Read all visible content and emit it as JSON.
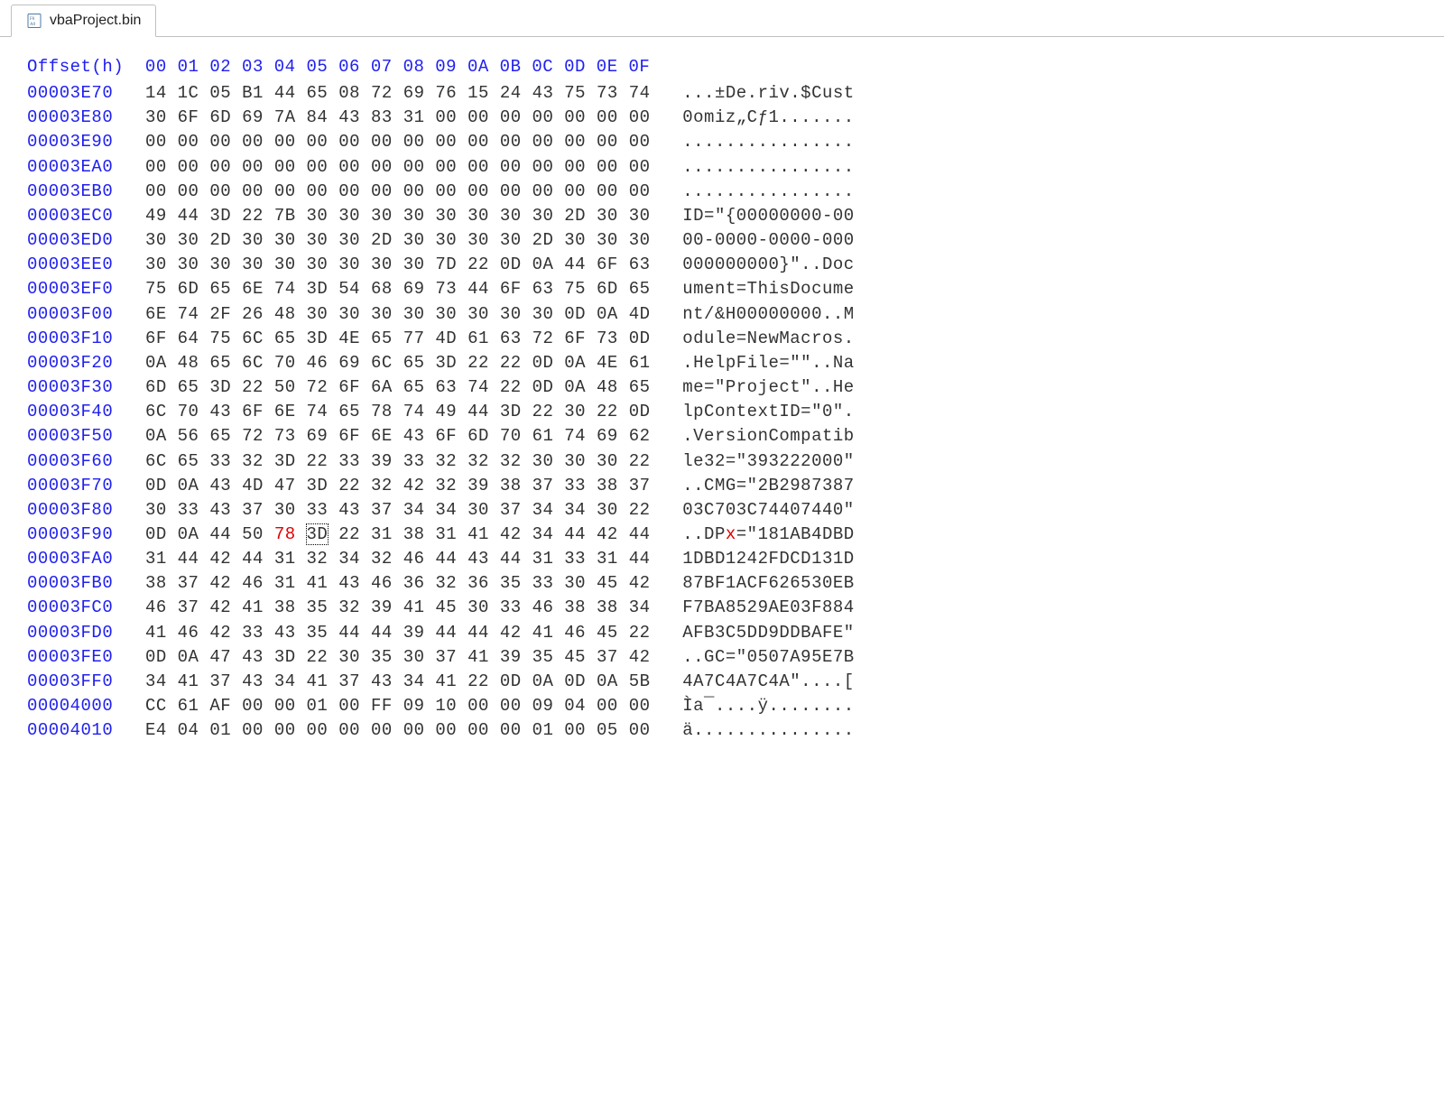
{
  "tab": {
    "title": "vbaProject.bin"
  },
  "header": "Offset(h)  00 01 02 03 04 05 06 07 08 09 0A 0B 0C 0D 0E 0F",
  "rows": [
    {
      "offset": "00003E70",
      "bytes": [
        "14",
        "1C",
        "05",
        "B1",
        "44",
        "65",
        "08",
        "72",
        "69",
        "76",
        "15",
        "24",
        "43",
        "75",
        "73",
        "74"
      ],
      "ascii": "...±De.riv.$Cust"
    },
    {
      "offset": "00003E80",
      "bytes": [
        "30",
        "6F",
        "6D",
        "69",
        "7A",
        "84",
        "43",
        "83",
        "31",
        "00",
        "00",
        "00",
        "00",
        "00",
        "00",
        "00"
      ],
      "ascii": "0omiz„Cƒ1......."
    },
    {
      "offset": "00003E90",
      "bytes": [
        "00",
        "00",
        "00",
        "00",
        "00",
        "00",
        "00",
        "00",
        "00",
        "00",
        "00",
        "00",
        "00",
        "00",
        "00",
        "00"
      ],
      "ascii": "................"
    },
    {
      "offset": "00003EA0",
      "bytes": [
        "00",
        "00",
        "00",
        "00",
        "00",
        "00",
        "00",
        "00",
        "00",
        "00",
        "00",
        "00",
        "00",
        "00",
        "00",
        "00"
      ],
      "ascii": "................"
    },
    {
      "offset": "00003EB0",
      "bytes": [
        "00",
        "00",
        "00",
        "00",
        "00",
        "00",
        "00",
        "00",
        "00",
        "00",
        "00",
        "00",
        "00",
        "00",
        "00",
        "00"
      ],
      "ascii": "................"
    },
    {
      "offset": "00003EC0",
      "bytes": [
        "49",
        "44",
        "3D",
        "22",
        "7B",
        "30",
        "30",
        "30",
        "30",
        "30",
        "30",
        "30",
        "30",
        "2D",
        "30",
        "30"
      ],
      "ascii": "ID=\"{00000000-00"
    },
    {
      "offset": "00003ED0",
      "bytes": [
        "30",
        "30",
        "2D",
        "30",
        "30",
        "30",
        "30",
        "2D",
        "30",
        "30",
        "30",
        "30",
        "2D",
        "30",
        "30",
        "30"
      ],
      "ascii": "00-0000-0000-000"
    },
    {
      "offset": "00003EE0",
      "bytes": [
        "30",
        "30",
        "30",
        "30",
        "30",
        "30",
        "30",
        "30",
        "30",
        "7D",
        "22",
        "0D",
        "0A",
        "44",
        "6F",
        "63"
      ],
      "ascii": "000000000}\"..Doc"
    },
    {
      "offset": "00003EF0",
      "bytes": [
        "75",
        "6D",
        "65",
        "6E",
        "74",
        "3D",
        "54",
        "68",
        "69",
        "73",
        "44",
        "6F",
        "63",
        "75",
        "6D",
        "65"
      ],
      "ascii": "ument=ThisDocume"
    },
    {
      "offset": "00003F00",
      "bytes": [
        "6E",
        "74",
        "2F",
        "26",
        "48",
        "30",
        "30",
        "30",
        "30",
        "30",
        "30",
        "30",
        "30",
        "0D",
        "0A",
        "4D"
      ],
      "ascii": "nt/&H00000000..M"
    },
    {
      "offset": "00003F10",
      "bytes": [
        "6F",
        "64",
        "75",
        "6C",
        "65",
        "3D",
        "4E",
        "65",
        "77",
        "4D",
        "61",
        "63",
        "72",
        "6F",
        "73",
        "0D"
      ],
      "ascii": "odule=NewMacros."
    },
    {
      "offset": "00003F20",
      "bytes": [
        "0A",
        "48",
        "65",
        "6C",
        "70",
        "46",
        "69",
        "6C",
        "65",
        "3D",
        "22",
        "22",
        "0D",
        "0A",
        "4E",
        "61"
      ],
      "ascii": ".HelpFile=\"\"..Na"
    },
    {
      "offset": "00003F30",
      "bytes": [
        "6D",
        "65",
        "3D",
        "22",
        "50",
        "72",
        "6F",
        "6A",
        "65",
        "63",
        "74",
        "22",
        "0D",
        "0A",
        "48",
        "65"
      ],
      "ascii": "me=\"Project\"..He"
    },
    {
      "offset": "00003F40",
      "bytes": [
        "6C",
        "70",
        "43",
        "6F",
        "6E",
        "74",
        "65",
        "78",
        "74",
        "49",
        "44",
        "3D",
        "22",
        "30",
        "22",
        "0D"
      ],
      "ascii": "lpContextID=\"0\"."
    },
    {
      "offset": "00003F50",
      "bytes": [
        "0A",
        "56",
        "65",
        "72",
        "73",
        "69",
        "6F",
        "6E",
        "43",
        "6F",
        "6D",
        "70",
        "61",
        "74",
        "69",
        "62"
      ],
      "ascii": ".VersionCompatib"
    },
    {
      "offset": "00003F60",
      "bytes": [
        "6C",
        "65",
        "33",
        "32",
        "3D",
        "22",
        "33",
        "39",
        "33",
        "32",
        "32",
        "32",
        "30",
        "30",
        "30",
        "22"
      ],
      "ascii": "le32=\"393222000\""
    },
    {
      "offset": "00003F70",
      "bytes": [
        "0D",
        "0A",
        "43",
        "4D",
        "47",
        "3D",
        "22",
        "32",
        "42",
        "32",
        "39",
        "38",
        "37",
        "33",
        "38",
        "37"
      ],
      "ascii": "..CMG=\"2B2987387"
    },
    {
      "offset": "00003F80",
      "bytes": [
        "30",
        "33",
        "43",
        "37",
        "30",
        "33",
        "43",
        "37",
        "34",
        "34",
        "30",
        "37",
        "34",
        "34",
        "30",
        "22"
      ],
      "ascii": "03C703C74407440\""
    },
    {
      "offset": "00003F90",
      "bytes": [
        "0D",
        "0A",
        "44",
        "50",
        "78",
        "3D",
        "22",
        "31",
        "38",
        "31",
        "41",
        "42",
        "34",
        "44",
        "42",
        "44"
      ],
      "ascii_pre": "..DP",
      "ascii_red": "x",
      "ascii_post": "=\"181AB4DBD",
      "red_byte_index": 4,
      "sel_byte_index": 5
    },
    {
      "offset": "00003FA0",
      "bytes": [
        "31",
        "44",
        "42",
        "44",
        "31",
        "32",
        "34",
        "32",
        "46",
        "44",
        "43",
        "44",
        "31",
        "33",
        "31",
        "44"
      ],
      "ascii": "1DBD1242FDCD131D"
    },
    {
      "offset": "00003FB0",
      "bytes": [
        "38",
        "37",
        "42",
        "46",
        "31",
        "41",
        "43",
        "46",
        "36",
        "32",
        "36",
        "35",
        "33",
        "30",
        "45",
        "42"
      ],
      "ascii": "87BF1ACF626530EB"
    },
    {
      "offset": "00003FC0",
      "bytes": [
        "46",
        "37",
        "42",
        "41",
        "38",
        "35",
        "32",
        "39",
        "41",
        "45",
        "30",
        "33",
        "46",
        "38",
        "38",
        "34"
      ],
      "ascii": "F7BA8529AE03F884"
    },
    {
      "offset": "00003FD0",
      "bytes": [
        "41",
        "46",
        "42",
        "33",
        "43",
        "35",
        "44",
        "44",
        "39",
        "44",
        "44",
        "42",
        "41",
        "46",
        "45",
        "22"
      ],
      "ascii": "AFB3C5DD9DDBAFE\""
    },
    {
      "offset": "00003FE0",
      "bytes": [
        "0D",
        "0A",
        "47",
        "43",
        "3D",
        "22",
        "30",
        "35",
        "30",
        "37",
        "41",
        "39",
        "35",
        "45",
        "37",
        "42"
      ],
      "ascii": "..GC=\"0507A95E7B"
    },
    {
      "offset": "00003FF0",
      "bytes": [
        "34",
        "41",
        "37",
        "43",
        "34",
        "41",
        "37",
        "43",
        "34",
        "41",
        "22",
        "0D",
        "0A",
        "0D",
        "0A",
        "5B"
      ],
      "ascii": "4A7C4A7C4A\"....["
    },
    {
      "offset": "00004000",
      "bytes": [
        "CC",
        "61",
        "AF",
        "00",
        "00",
        "01",
        "00",
        "FF",
        "09",
        "10",
        "00",
        "00",
        "09",
        "04",
        "00",
        "00"
      ],
      "ascii": "Ìa¯....ÿ........"
    },
    {
      "offset": "00004010",
      "bytes": [
        "E4",
        "04",
        "01",
        "00",
        "00",
        "00",
        "00",
        "00",
        "00",
        "00",
        "00",
        "00",
        "01",
        "00",
        "05",
        "00"
      ],
      "ascii": "ä..............."
    }
  ]
}
